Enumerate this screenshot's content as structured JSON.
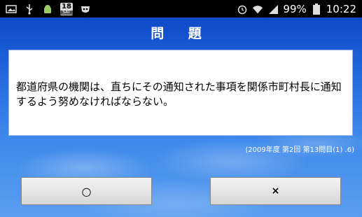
{
  "status_bar": {
    "calendar_day": "18",
    "calendar_weekday": "SAT",
    "battery": "99%",
    "time": "10:22",
    "icons": [
      "photo-icon",
      "usb-icon",
      "android-debug-icon",
      "calendar-icon",
      "privacy-mask-icon",
      "alarm-icon",
      "wifi-icon",
      "signal-icon",
      "battery-icon"
    ]
  },
  "header": {
    "title": "問 題"
  },
  "question": {
    "text": "都道府県の機関は、直ちにその通知された事項を関係市町村長に通知するよう努めなければならない。",
    "source": "(2009年度 第2回 第13問目(1) .6)"
  },
  "answers": {
    "true_label": "○",
    "false_label": "×"
  }
}
